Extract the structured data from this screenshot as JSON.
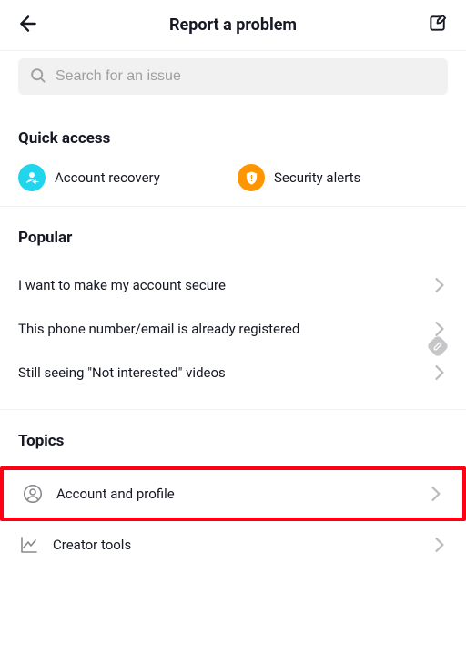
{
  "header": {
    "title": "Report a problem"
  },
  "search": {
    "placeholder": "Search for an issue"
  },
  "quick_access": {
    "heading": "Quick access",
    "items": [
      {
        "label": "Account recovery",
        "icon": "account-recovery"
      },
      {
        "label": "Security alerts",
        "icon": "security-alert"
      }
    ]
  },
  "popular": {
    "heading": "Popular",
    "items": [
      {
        "label": "I want to make my account secure"
      },
      {
        "label": "This phone number/email is already registered"
      },
      {
        "label": "Still seeing \"Not interested\" videos",
        "has_info_badge": true
      }
    ]
  },
  "topics": {
    "heading": "Topics",
    "items": [
      {
        "label": "Account and profile",
        "icon": "person-circle",
        "highlighted": true
      },
      {
        "label": "Creator tools",
        "icon": "analytics"
      }
    ]
  }
}
